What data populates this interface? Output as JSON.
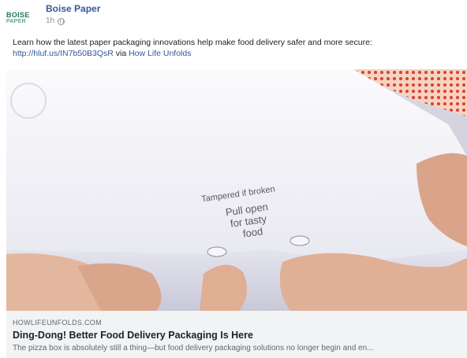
{
  "post": {
    "page_logo": {
      "line1": "BOISE",
      "line2": "PAPER"
    },
    "page_name": "Boise Paper",
    "time": "1h",
    "privacy_icon": "globe-icon",
    "text_prefix": "Learn how the latest paper packaging innovations help make food delivery safer and more secure:",
    "link_url": "http://hluf.us/IN7b50B3QsR",
    "via_text": " via ",
    "via_source": "How Life Unfolds"
  },
  "media": {
    "box_seal_top": "Tampered if broken",
    "box_seal_line1": "Pull open",
    "box_seal_line2": "for tasty",
    "box_seal_line3": "food"
  },
  "link_preview": {
    "domain": "HOWLIFEUNFOLDS.COM",
    "title": "Ding-Dong! Better Food Delivery Packaging Is Here",
    "description": "The pizza box is absolutely still a thing—but food delivery packaging solutions no longer begin and en..."
  },
  "colors": {
    "link": "#365899",
    "brand_green": "#1e7b4f",
    "card_bg": "#f2f3f5"
  }
}
